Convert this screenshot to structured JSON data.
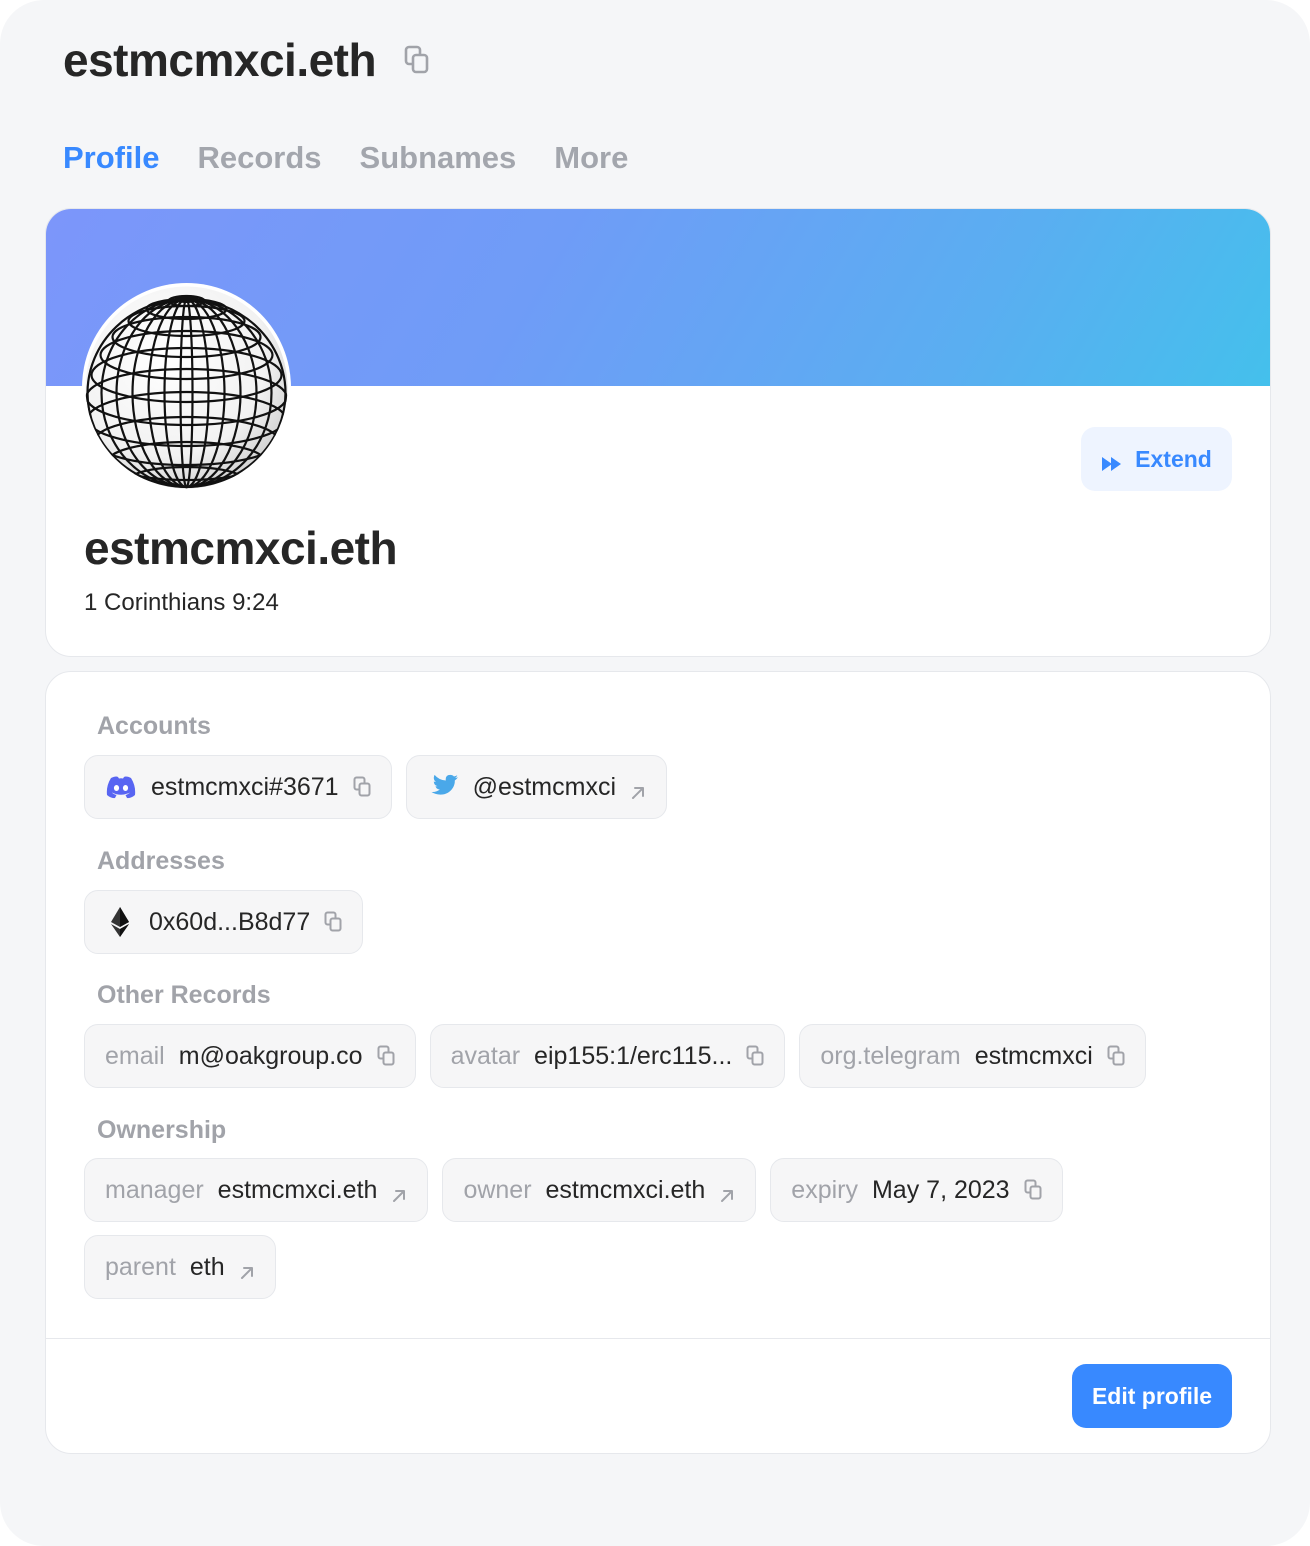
{
  "header": {
    "title": "estmcmxci.eth"
  },
  "tabs": [
    {
      "label": "Profile",
      "active": true
    },
    {
      "label": "Records",
      "active": false
    },
    {
      "label": "Subnames",
      "active": false
    },
    {
      "label": "More",
      "active": false
    }
  ],
  "profile": {
    "name": "estmcmxci.eth",
    "description": "1 Corinthians 9:24",
    "extend_label": "Extend",
    "avatar_icon": "wireframe-globe-icon",
    "banner_colors": [
      "#7c96fa",
      "#44c0ec"
    ]
  },
  "accounts": {
    "label": "Accounts",
    "items": [
      {
        "icon": "discord-icon",
        "value": "estmcmxci#3671",
        "action_icon": "copy-icon"
      },
      {
        "icon": "twitter-icon",
        "value": "@estmcmxci",
        "action_icon": "external-link-icon"
      }
    ]
  },
  "addresses": {
    "label": "Addresses",
    "items": [
      {
        "icon": "ethereum-icon",
        "value": "0x60d...B8d77",
        "action_icon": "copy-icon"
      }
    ]
  },
  "other_records": {
    "label": "Other Records",
    "items": [
      {
        "key": "email",
        "value": "m@oakgroup.co",
        "action_icon": "copy-icon"
      },
      {
        "key": "avatar",
        "value": "eip155:1/erc115...",
        "action_icon": "copy-icon"
      },
      {
        "key": "org.telegram",
        "value": "estmcmxci",
        "action_icon": "copy-icon"
      }
    ]
  },
  "ownership": {
    "label": "Ownership",
    "items": [
      {
        "key": "manager",
        "value": "estmcmxci.eth",
        "action_icon": "external-link-icon"
      },
      {
        "key": "owner",
        "value": "estmcmxci.eth",
        "action_icon": "external-link-icon"
      },
      {
        "key": "expiry",
        "value": "May 7, 2023",
        "action_icon": "copy-icon"
      },
      {
        "key": "parent",
        "value": "eth",
        "action_icon": "external-link-icon"
      }
    ]
  },
  "footer": {
    "edit_label": "Edit profile"
  },
  "colors": {
    "accent": "#3889ff",
    "muted": "#a1a3a9",
    "text": "#262626"
  }
}
